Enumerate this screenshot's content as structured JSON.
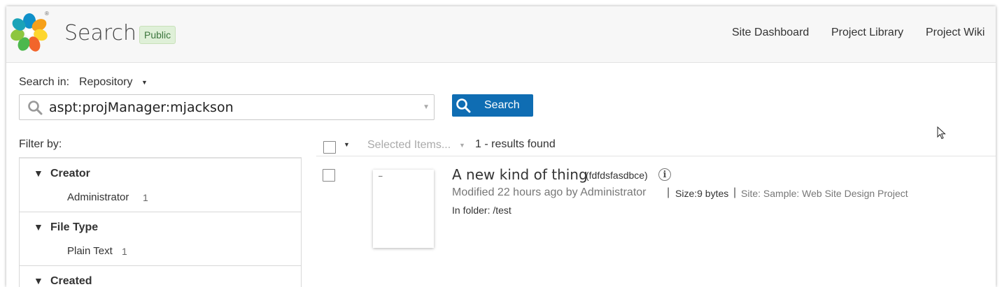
{
  "header": {
    "title": "Search",
    "badge": "Public",
    "reg_mark": "®",
    "nav": [
      "Site Dashboard",
      "Project Library",
      "Project Wiki"
    ]
  },
  "search": {
    "scope_label": "Search in:",
    "scope_value": "Repository",
    "query": "aspt:projManager:mjackson",
    "button_label": "Search"
  },
  "filters": {
    "label": "Filter by:",
    "facets": [
      {
        "name": "Creator",
        "value": "Administrator",
        "count": "1"
      },
      {
        "name": "File Type",
        "value": "Plain Text",
        "count": "1"
      },
      {
        "name": "Created"
      }
    ]
  },
  "results_bar": {
    "selected_items": "Selected Items...",
    "count_text": "1 - results found"
  },
  "result": {
    "title": "A new kind of thing",
    "name": "(fdfdsfasdbce)",
    "modified": "Modified 22 hours ago by Administrator",
    "size": "Size:9 bytes",
    "site": "Site: Sample: Web Site Design Project",
    "folder": "In folder: /test",
    "thumb_text": "–"
  },
  "colors": {
    "primary": "#0f6db3",
    "badge_bg": "#dff0d8",
    "badge_text": "#3c763d",
    "header_bg": "#f7f7f7"
  },
  "icons": [
    "alfresco-logo-icon",
    "search-icon",
    "dropdown-caret-icon",
    "collapse-triangle-icon",
    "info-icon",
    "mouse-cursor-icon"
  ]
}
